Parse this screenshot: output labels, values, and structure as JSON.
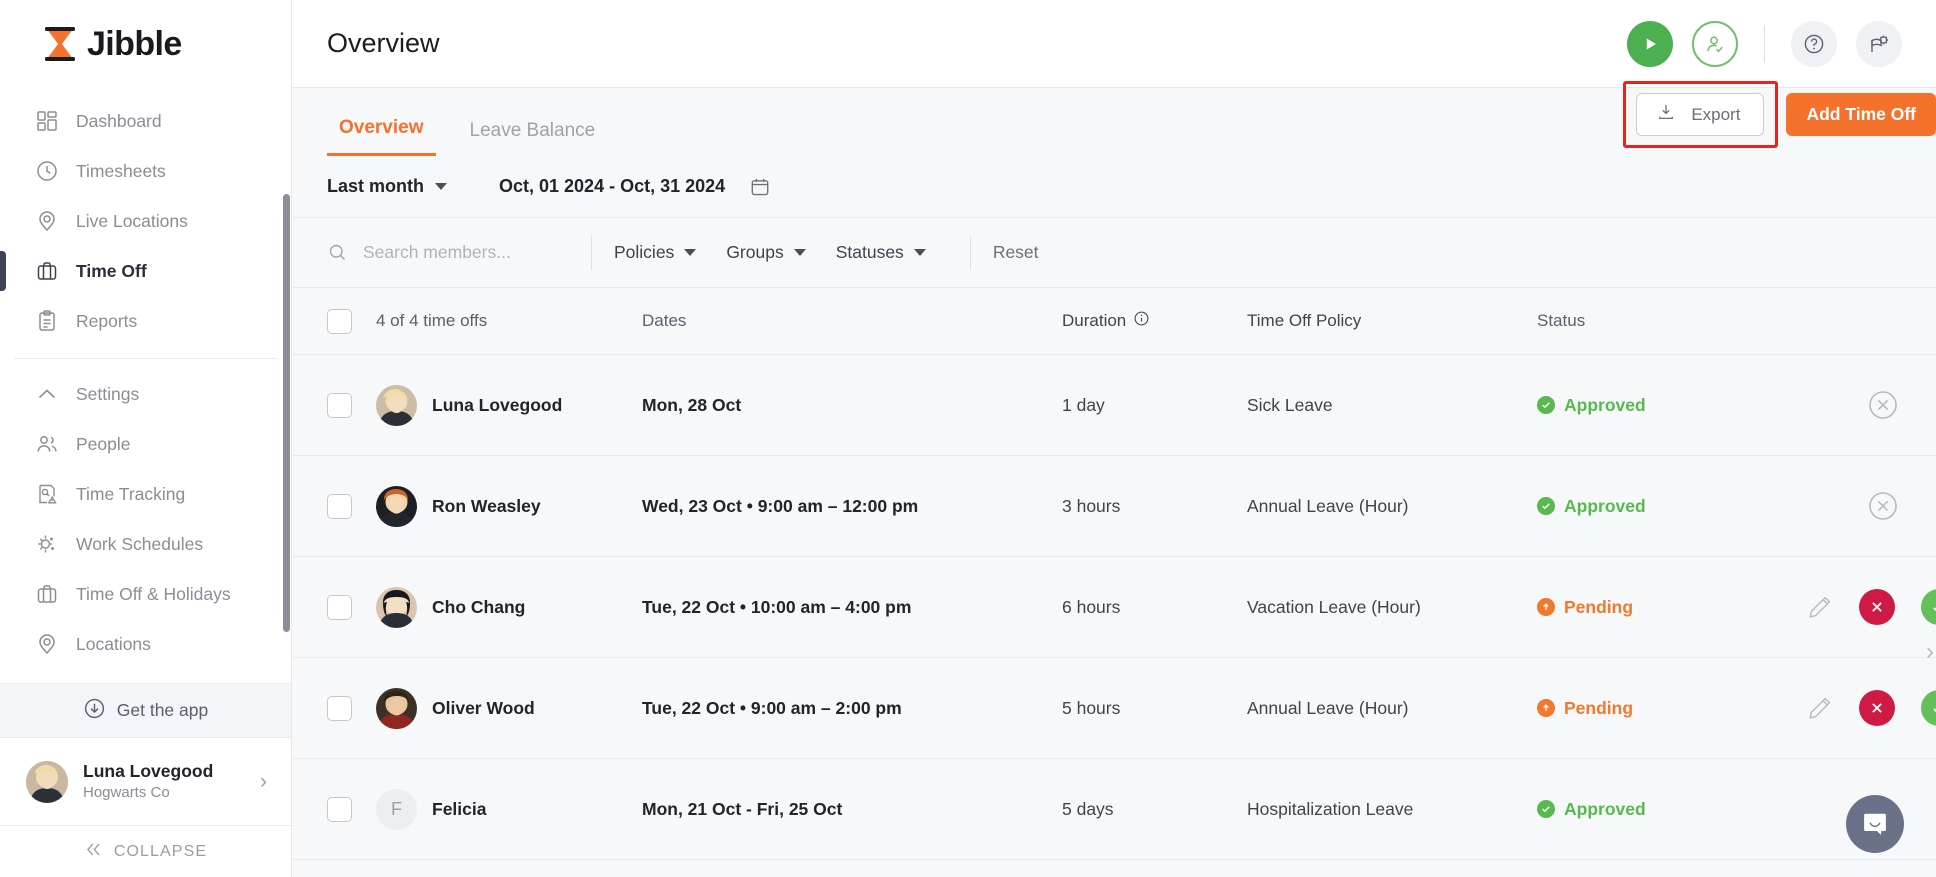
{
  "brand": {
    "name": "Jibble",
    "logo_icon": "hourglass-icon"
  },
  "sidebar": {
    "primary": [
      {
        "label": "Dashboard",
        "icon": "dashboard-icon",
        "active": false
      },
      {
        "label": "Timesheets",
        "icon": "clock-icon",
        "active": false
      },
      {
        "label": "Live Locations",
        "icon": "pin-icon",
        "active": false
      },
      {
        "label": "Time Off",
        "icon": "briefcase-icon",
        "active": true
      },
      {
        "label": "Reports",
        "icon": "clipboard-icon",
        "active": false
      }
    ],
    "secondary": [
      {
        "label": "Settings",
        "icon": "chevron-up-icon",
        "active": false
      },
      {
        "label": "People",
        "icon": "people-icon",
        "active": false
      },
      {
        "label": "Time Tracking",
        "icon": "time-tracking-icon",
        "active": false
      },
      {
        "label": "Work Schedules",
        "icon": "work-schedules-icon",
        "active": false
      },
      {
        "label": "Time Off & Holidays",
        "icon": "briefcase-icon",
        "active": false
      },
      {
        "label": "Locations",
        "icon": "pin-icon",
        "active": false
      }
    ],
    "get_the_app": "Get the app",
    "profile": {
      "name": "Luna Lovegood",
      "org": "Hogwarts Co"
    },
    "collapse": "COLLAPSE"
  },
  "header": {
    "title": "Overview",
    "icons": [
      "play-icon",
      "person-check-icon",
      "help-icon",
      "whats-new-icon"
    ]
  },
  "tabs": [
    {
      "label": "Overview",
      "active": true
    },
    {
      "label": "Leave Balance",
      "active": false
    }
  ],
  "actions": {
    "export_label": "Export",
    "add_label": "Add Time Off",
    "highlight_color": "#e8231b",
    "accent_color": "#f4722b"
  },
  "date_filter": {
    "preset": "Last month",
    "range": "Oct, 01 2024 - Oct, 31 2024",
    "calendar_icon": "calendar-icon"
  },
  "filters": {
    "search_placeholder": "Search members...",
    "search_value": "",
    "dropdowns": [
      "Policies",
      "Groups",
      "Statuses"
    ],
    "reset_label": "Reset"
  },
  "table": {
    "headers": {
      "count": "4 of 4 time offs",
      "dates": "Dates",
      "duration": "Duration",
      "policy": "Time Off Policy",
      "status": "Status"
    },
    "rows": [
      {
        "member": "Luna Lovegood",
        "avatar": "photo",
        "dates": "Mon, 28 Oct",
        "duration": "1 day",
        "policy": "Sick Leave",
        "status": "Approved",
        "status_kind": "approved",
        "actions": [
          "cancel-icon"
        ]
      },
      {
        "member": "Ron Weasley",
        "avatar": "photo",
        "dates": "Wed, 23 Oct • 9:00 am – 12:00 pm",
        "duration": "3 hours",
        "policy": "Annual Leave (Hour)",
        "status": "Approved",
        "status_kind": "approved",
        "actions": [
          "cancel-icon"
        ]
      },
      {
        "member": "Cho Chang",
        "avatar": "photo",
        "dates": "Tue, 22 Oct • 10:00 am – 4:00 pm",
        "duration": "6 hours",
        "policy": "Vacation Leave (Hour)",
        "status": "Pending",
        "status_kind": "pending",
        "actions": [
          "edit-icon",
          "reject-icon",
          "approve-icon"
        ]
      },
      {
        "member": "Oliver Wood",
        "avatar": "photo",
        "dates": "Tue, 22 Oct • 9:00 am – 2:00 pm",
        "duration": "5 hours",
        "policy": "Annual Leave (Hour)",
        "status": "Pending",
        "status_kind": "pending",
        "actions": [
          "edit-icon",
          "reject-icon",
          "approve-icon"
        ]
      },
      {
        "member": "Felicia",
        "avatar": "initial",
        "avatar_initial": "F",
        "dates": "Mon, 21 Oct - Fri, 25 Oct",
        "duration": "5 days",
        "policy": "Hospitalization Leave",
        "status": "Approved",
        "status_kind": "approved",
        "actions": []
      }
    ]
  },
  "chat": {
    "icon": "chat-bubble-icon"
  }
}
